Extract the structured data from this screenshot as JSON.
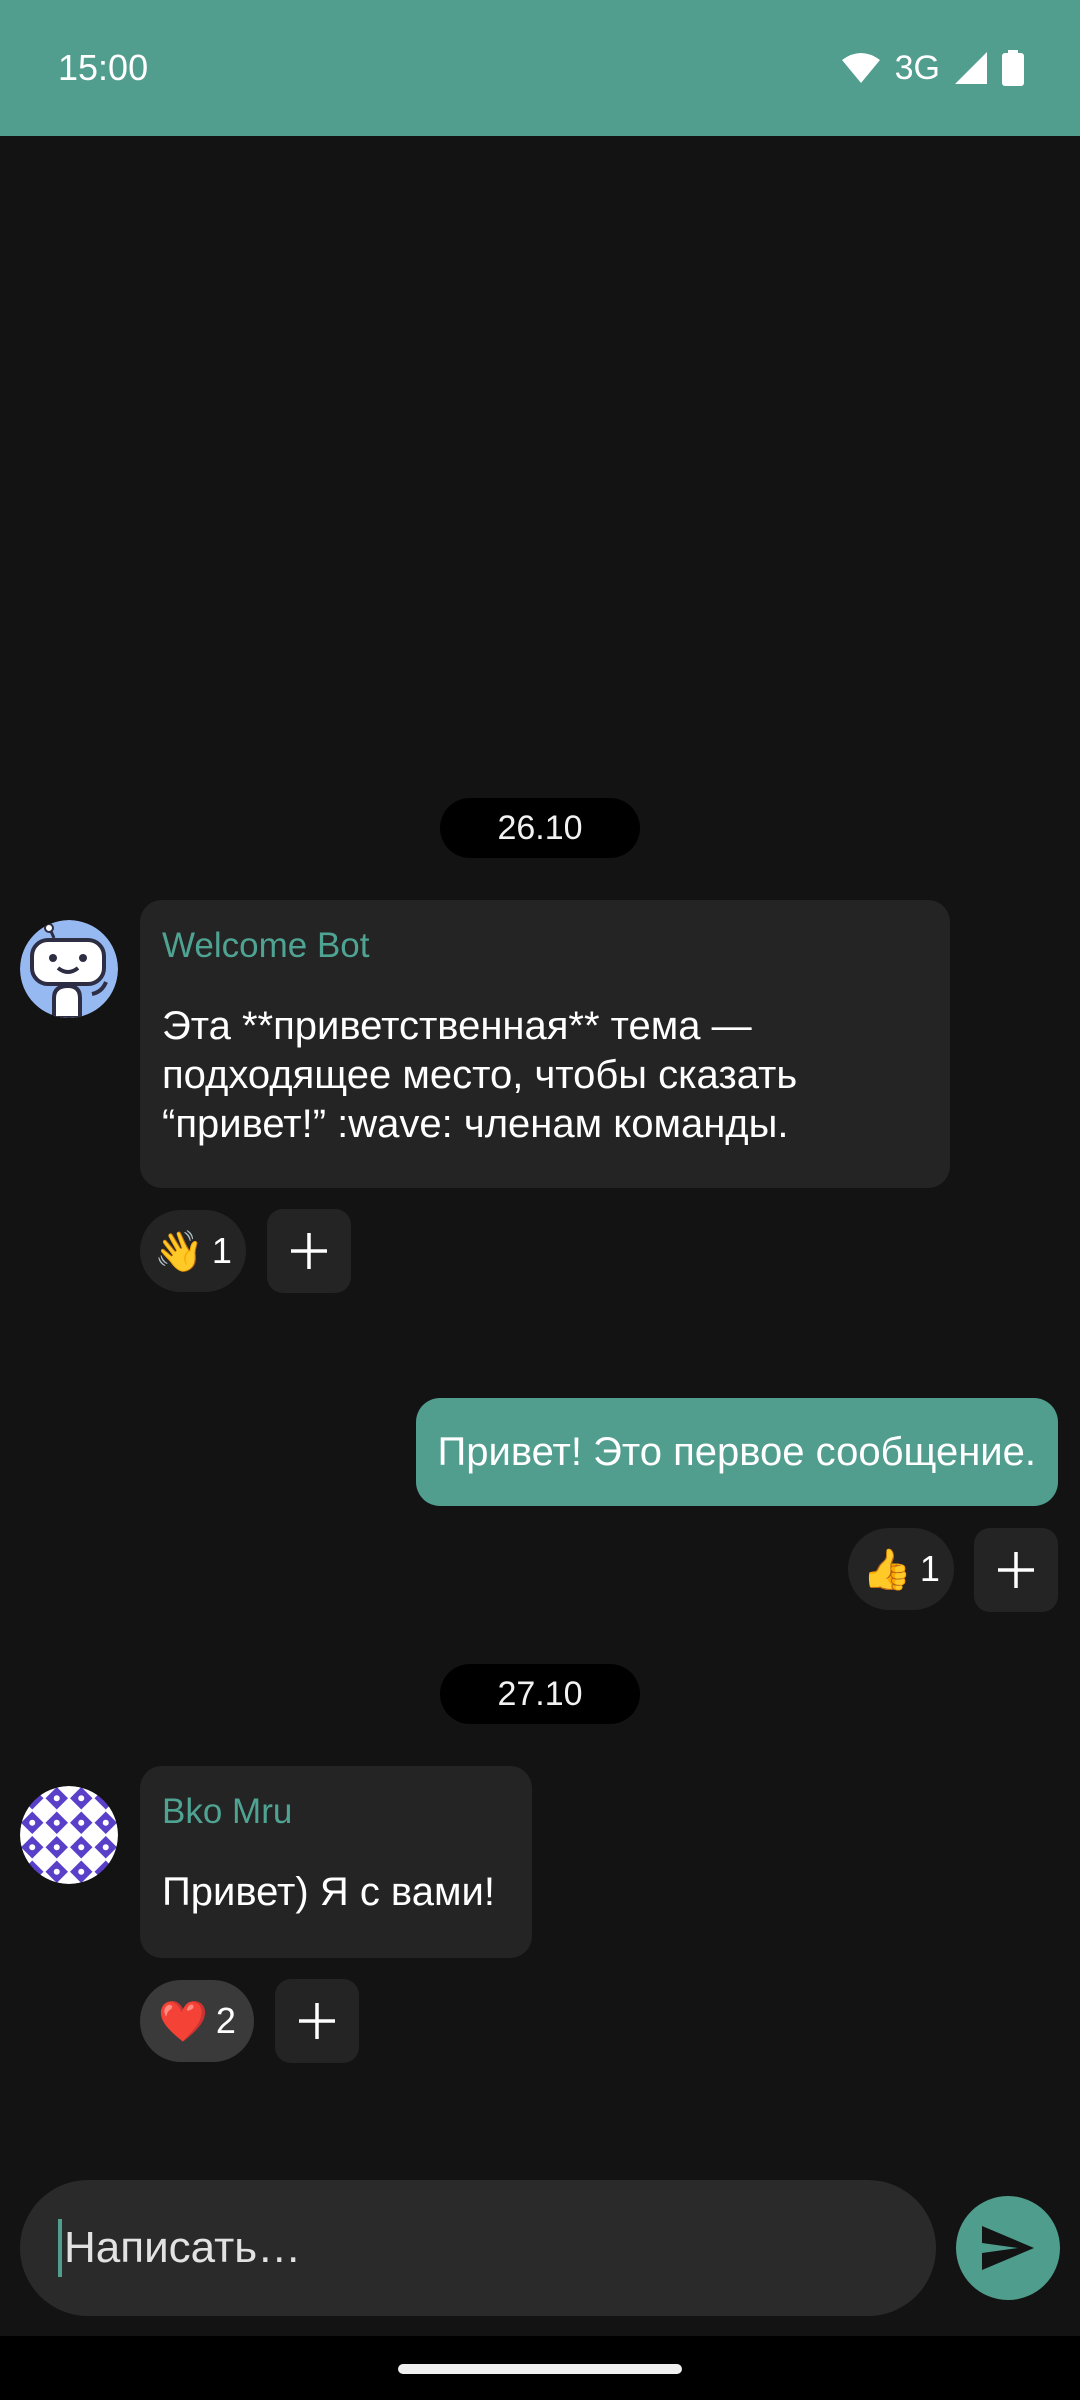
{
  "status_bar": {
    "time": "15:00",
    "network": "3G",
    "icons": [
      "wifi-icon",
      "signal-icon",
      "battery-icon"
    ],
    "background": "#519d8e"
  },
  "chat": {
    "groups": [
      {
        "date": "26.10",
        "message": {
          "sender": "Welcome Bot",
          "text": "Эта **приветственная** тема —\nподходящее место, чтобы сказать\n“привет!” :wave: членам команды.",
          "avatar_icon": "robot-avatar-icon",
          "reactions": [
            {
              "emoji": "👋",
              "count": "1"
            }
          ]
        },
        "outgoing": {
          "text": "Привет! Это первое сообщение.",
          "reactions": [
            {
              "emoji": "👍",
              "count": "1"
            }
          ]
        }
      },
      {
        "date": "27.10",
        "message": {
          "sender": "Bko Mru",
          "text": "Привет) Я с вами!",
          "avatar_icon": "pattern-avatar-icon",
          "reactions": [
            {
              "emoji": "❤️",
              "count": "2"
            }
          ]
        }
      }
    ]
  },
  "composer": {
    "placeholder": "Написать…",
    "value": ""
  },
  "colors": {
    "accent": "#519d8e",
    "background": "#131313",
    "bubble": "#242424",
    "sender_name": "#4fa392"
  }
}
